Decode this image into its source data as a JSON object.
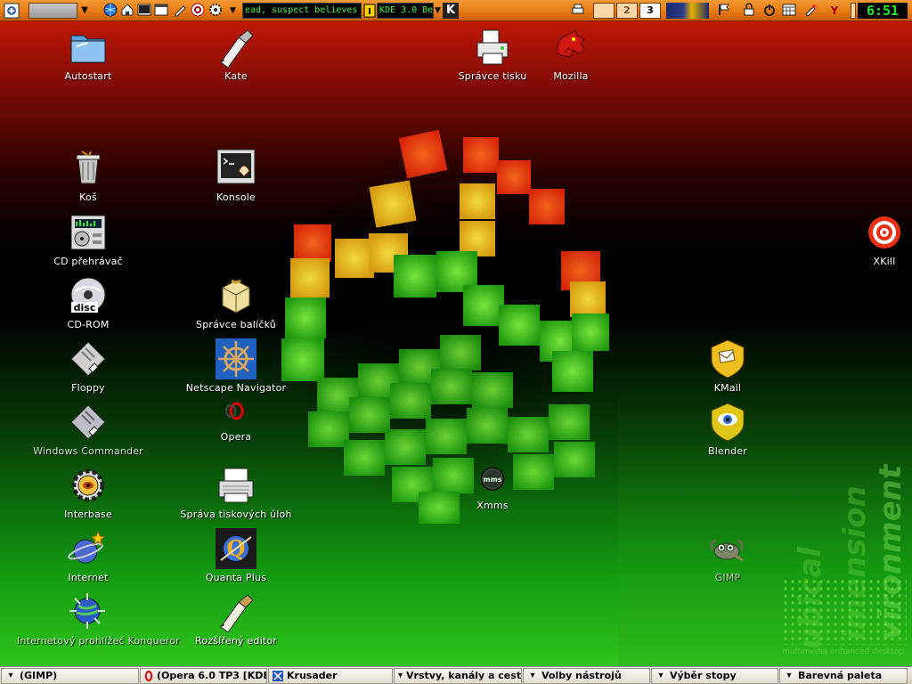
{
  "top_panel": {
    "ticker_text": "ead, suspect believes +++",
    "kde_label": "KDE 3.0 Bet",
    "desktop_number": "3",
    "pager_number": "2",
    "clock": "6:51",
    "icons": [
      "kde-menu-icon",
      "globe-icon",
      "home-icon",
      "terminal-icon",
      "window-icon",
      "pencil-icon",
      "help-icon",
      "gear-icon",
      "printer-icon",
      "flag-icon",
      "lock-icon",
      "power-icon",
      "calendar-icon",
      "paint-icon",
      "kde-y-icon"
    ]
  },
  "desktop": {
    "icons": [
      {
        "label": "Autostart",
        "icon": "folder-icon"
      },
      {
        "label": "Kate",
        "icon": "quill-pen-icon"
      },
      {
        "label": "Správce tisku",
        "icon": "printer-icon"
      },
      {
        "label": "Mozilla",
        "icon": "mozilla-icon"
      },
      {
        "label": "Koš",
        "icon": "trash-icon"
      },
      {
        "label": "Konsole",
        "icon": "konsole-icon"
      },
      {
        "label": "CD přehrávač",
        "icon": "cd-player-icon"
      },
      {
        "label": "CD-ROM",
        "icon": "cdrom-icon"
      },
      {
        "label": "Správce balíčků",
        "icon": "package-icon"
      },
      {
        "label": "Floppy",
        "icon": "floppy-icon"
      },
      {
        "label": "Netscape Navigator",
        "icon": "ship-wheel-icon"
      },
      {
        "label": "Windows Commander",
        "icon": "floppy-commander-icon"
      },
      {
        "label": "Opera",
        "icon": "opera-icon"
      },
      {
        "label": "Interbase",
        "icon": "interbase-icon"
      },
      {
        "label": "Správa tiskových úloh",
        "icon": "print-jobs-icon"
      },
      {
        "label": "Xmms",
        "icon": "xmms-icon"
      },
      {
        "label": "Internet",
        "icon": "internet-planet-icon"
      },
      {
        "label": "Quanta Plus",
        "icon": "quanta-icon"
      },
      {
        "label": "Internetový prohlížeč Konqueror",
        "icon": "konqueror-icon"
      },
      {
        "label": "Rozšířený editor",
        "icon": "editor-pen-icon"
      },
      {
        "label": "XKill",
        "icon": "xkill-target-icon"
      },
      {
        "label": "KMail",
        "icon": "kmail-icon"
      },
      {
        "label": "Blender",
        "icon": "blender-icon"
      },
      {
        "label": "GIMP",
        "icon": "gimp-icon"
      }
    ]
  },
  "watermark": {
    "words": [
      "ubical",
      "imension",
      "vironment"
    ],
    "subtitle": "multimedia enhanced desktop"
  },
  "taskbar": {
    "tasks": [
      {
        "label": "(GIMP)",
        "icon": "chevron-down-icon"
      },
      {
        "label": "(Opera 6.0 TP3 [KDE-",
        "icon": "opera-icon"
      },
      {
        "label": "Krusader",
        "icon": "krusader-icon"
      },
      {
        "label": "Vrstvy, kanály a cest",
        "icon": "chevron-down-icon"
      },
      {
        "label": "Volby nástrojů",
        "icon": "chevron-down-icon"
      },
      {
        "label": "Výběr stopy",
        "icon": "chevron-down-icon"
      },
      {
        "label": "Barevná paleta",
        "icon": "chevron-down-icon"
      }
    ]
  },
  "colors": {
    "panel_orange": "#e87a14",
    "ticker_green": "#3cf03c",
    "desktop_red": "#c01808",
    "desktop_green": "#2fc41c"
  }
}
